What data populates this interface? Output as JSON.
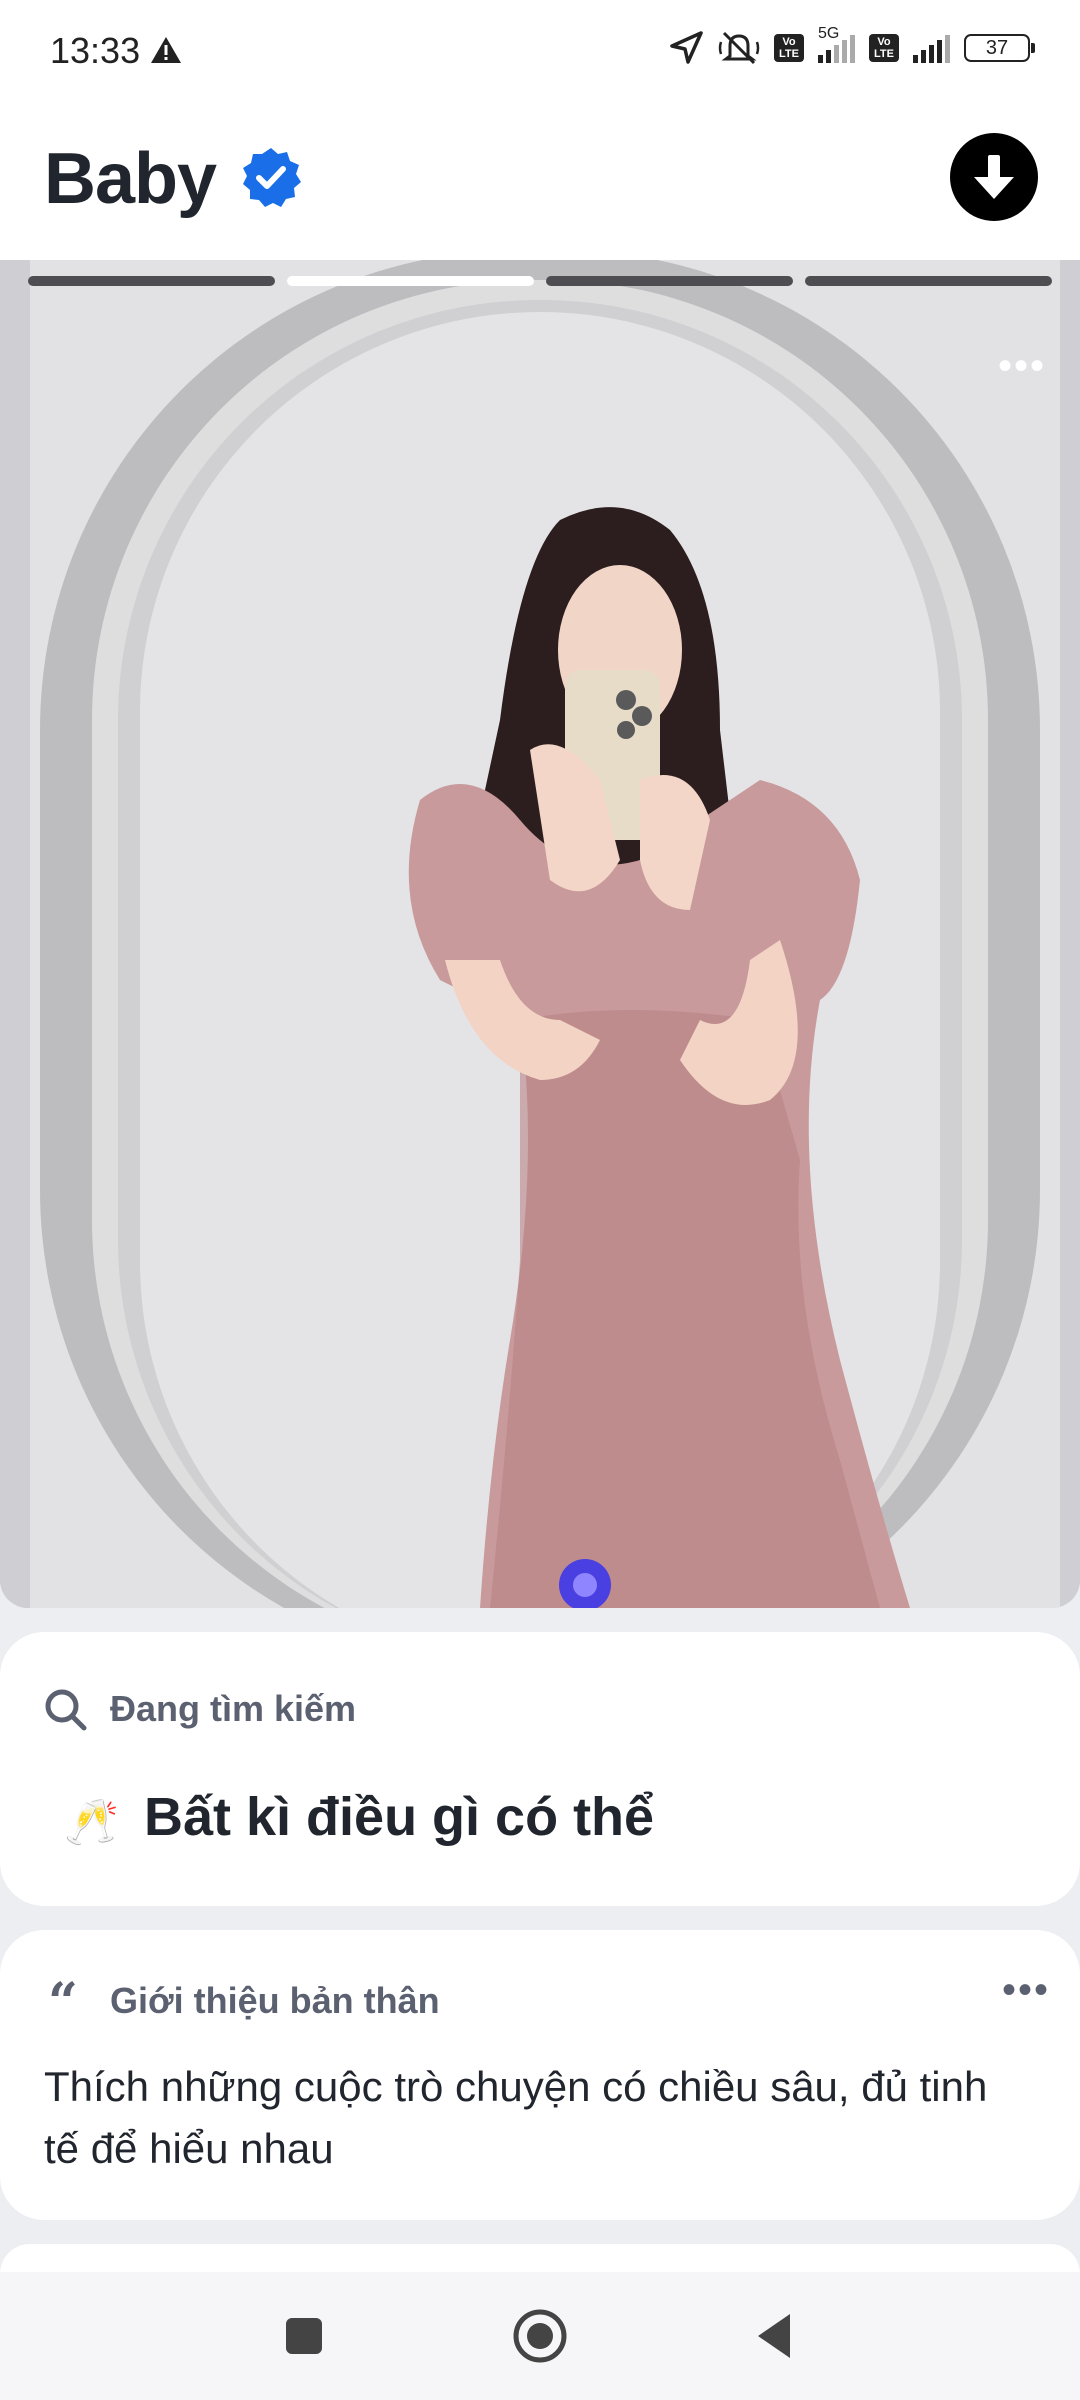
{
  "status_bar": {
    "time": "13:33",
    "network_labels": [
      "5G"
    ],
    "volte_label": "Vo LTE",
    "battery": "37"
  },
  "profile": {
    "name": "Baby",
    "verified": true,
    "photo_count": 4,
    "active_photo_index": 1
  },
  "looking_for": {
    "label": "Đang tìm kiếm",
    "emoji": "🥂",
    "value": "Bất kì điều gì có thể"
  },
  "bio": {
    "quote_icon": "“",
    "label": "Giới thiệu bản thân",
    "text": "Thích những cuộc trò chuyện có chiều sâu, đủ tinh tế để hiểu nhau"
  },
  "icons": {
    "verified": "verified-badge-icon",
    "download": "arrow-down-icon",
    "search": "search-icon",
    "quote": "quote-icon",
    "more": "more-dots-icon"
  },
  "colors": {
    "verified_blue": "#1a6fe8",
    "text_dark": "#21262e",
    "label_gray": "#5b6170",
    "background": "#eceef2"
  }
}
